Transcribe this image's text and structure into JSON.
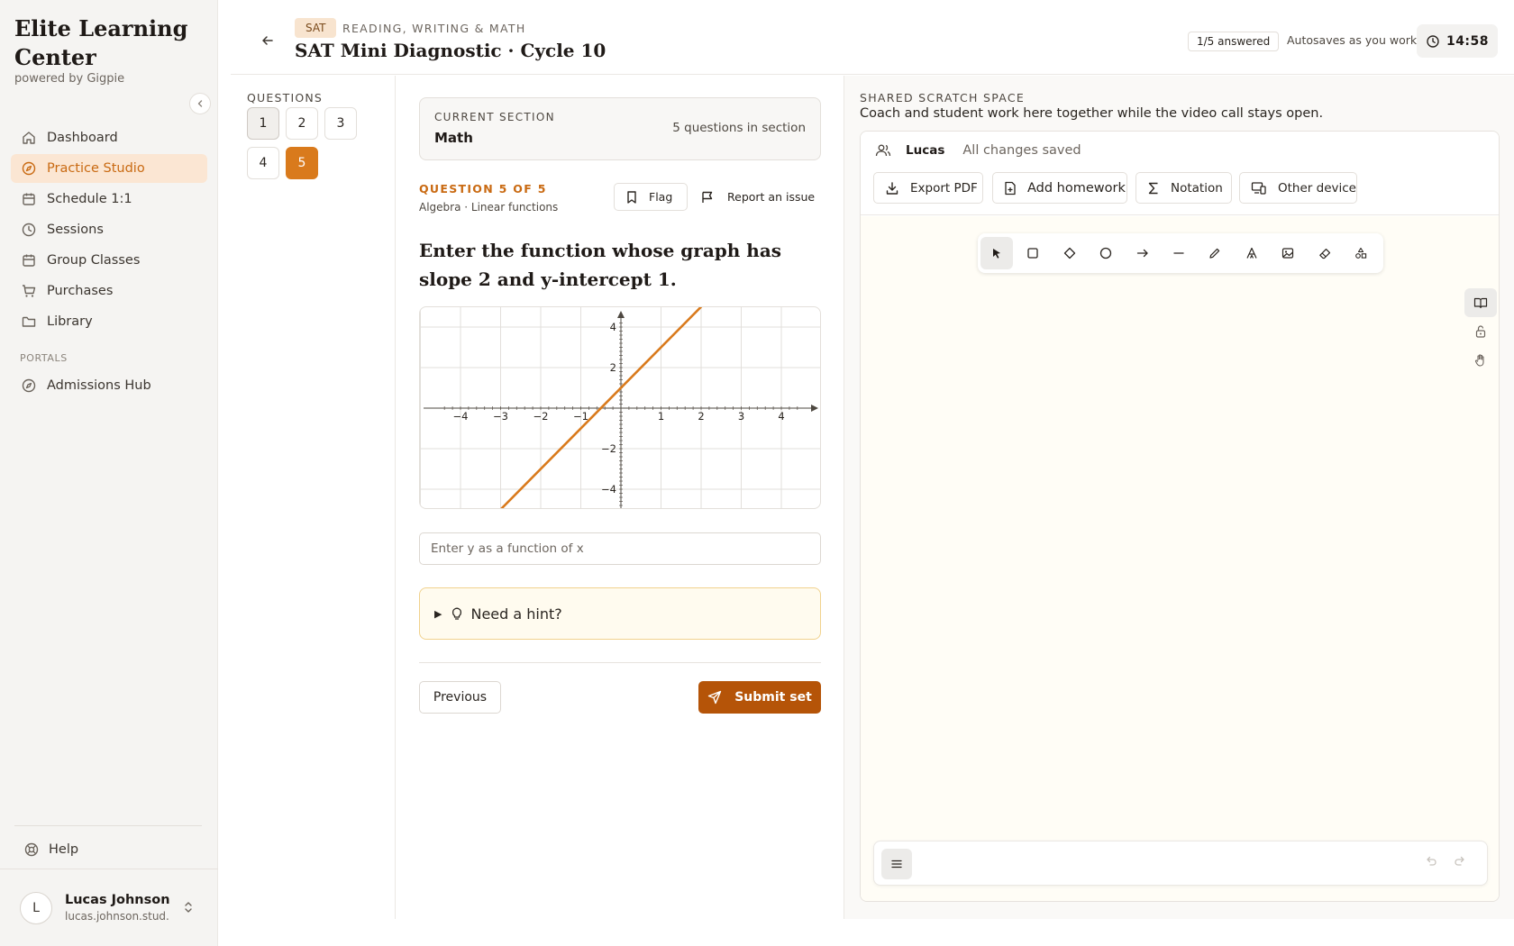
{
  "brand": {
    "title": "Elite Learning Center",
    "subtitle": "powered by Gigpie"
  },
  "sidebar": {
    "items": [
      {
        "label": "Dashboard",
        "icon": "home-icon"
      },
      {
        "label": "Practice Studio",
        "icon": "compass-icon",
        "active": true
      },
      {
        "label": "Schedule 1:1",
        "icon": "calendar-icon"
      },
      {
        "label": "Sessions",
        "icon": "clock-icon"
      },
      {
        "label": "Group Classes",
        "icon": "calendar-icon"
      },
      {
        "label": "Purchases",
        "icon": "cart-icon"
      },
      {
        "label": "Library",
        "icon": "folder-icon"
      }
    ],
    "portals_label": "PORTALS",
    "portals": [
      {
        "label": "Admissions Hub",
        "icon": "compass-icon"
      }
    ],
    "help_label": "Help",
    "user": {
      "initial": "L",
      "name": "Lucas Johnson",
      "email": "lucas.johnson.stud..."
    }
  },
  "header": {
    "badge": "SAT",
    "kicker": "READING, WRITING & MATH",
    "title": "SAT Mini Diagnostic · Cycle 10",
    "answered": "1/5 answered",
    "autosave": "Autosaves as you work",
    "timer": "14:58"
  },
  "questions_nav": {
    "label": "QUESTIONS",
    "items": [
      {
        "number": "1",
        "state": "visited"
      },
      {
        "number": "2",
        "state": "default"
      },
      {
        "number": "3",
        "state": "default"
      },
      {
        "number": "4",
        "state": "default"
      },
      {
        "number": "5",
        "state": "current"
      }
    ]
  },
  "section": {
    "label": "CURRENT SECTION",
    "name": "Math",
    "count": "5 questions in section"
  },
  "question": {
    "kicker": "QUESTION 5 OF 5",
    "topic": "Algebra · Linear functions",
    "flag_label": "Flag",
    "report_label": "Report an issue",
    "prompt": "Enter the function whose graph has slope 2 and y-intercept 1.",
    "answer_placeholder": "Enter y as a function of x",
    "answer_value": "",
    "hint_label": "Need a hint?",
    "previous_label": "Previous",
    "submit_label": "Submit set"
  },
  "graph": {
    "x_ticks": [
      "−4",
      "−3",
      "−2",
      "−1",
      "1",
      "2",
      "3",
      "4"
    ],
    "y_ticks": [
      "4",
      "2",
      "−2",
      "−4"
    ],
    "slope": 2,
    "intercept": 1,
    "line_color": "#d97a1c"
  },
  "scratch": {
    "label": "SHARED SCRATCH SPACE",
    "description": "Coach and student work here together while the video call stays open.",
    "owner": "Lucas",
    "status": "All changes saved",
    "buttons": {
      "export": "Export PDF",
      "homework": "Add homework",
      "notation": "Notation",
      "device": "Other device"
    }
  },
  "colors": {
    "accent": "#d97a1c",
    "accent_dark": "#b55408",
    "active_nav_bg": "#fbe6d3"
  }
}
